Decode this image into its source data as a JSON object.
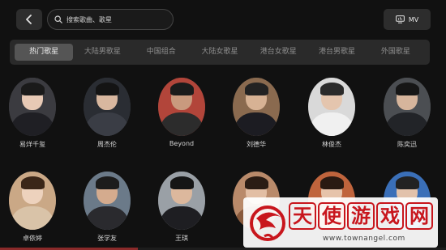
{
  "toolbar": {
    "back_icon": "chevron-left-icon",
    "search_placeholder": "搜索歌曲、歌星",
    "search_icon": "search-icon",
    "mv_label": "MV",
    "mv_icon": "mv-screen-icon"
  },
  "tabs": [
    {
      "label": "热门歌星",
      "active": true
    },
    {
      "label": "大陆男歌星",
      "active": false
    },
    {
      "label": "中国组合",
      "active": false
    },
    {
      "label": "大陆女歌星",
      "active": false
    },
    {
      "label": "港台女歌星",
      "active": false
    },
    {
      "label": "港台男歌星",
      "active": false
    },
    {
      "label": "外国歌星",
      "active": false
    }
  ],
  "artists": [
    {
      "name": "易烊千玺",
      "bg": "#3b3b40",
      "skin": "#e7c9b5",
      "hair": "#1a1a1a",
      "cloth": "#1f1f24"
    },
    {
      "name": "周杰伦",
      "bg": "#2a2d33",
      "skin": "#d8b79f",
      "hair": "#141414",
      "cloth": "#3a3d45"
    },
    {
      "name": "Beyond",
      "bg": "#b2453a",
      "skin": "#c99a7e",
      "hair": "#1b1b1b",
      "cloth": "#2c2c2c"
    },
    {
      "name": "刘德华",
      "bg": "#8a6a4f",
      "skin": "#d7b294",
      "hair": "#222222",
      "cloth": "#1c1c22"
    },
    {
      "name": "林俊杰",
      "bg": "#d9d9d9",
      "skin": "#e4c5ae",
      "hair": "#2a2a2a",
      "cloth": "#f0f0f0"
    },
    {
      "name": "陈奕迅",
      "bg": "#4b4e52",
      "skin": "#d6b59c",
      "hair": "#161616",
      "cloth": "#222428"
    },
    {
      "name": "卓依婷",
      "bg": "#caa886",
      "skin": "#edd2bd",
      "hair": "#3a2618",
      "cloth": "#d9c3a8"
    },
    {
      "name": "张学友",
      "bg": "#6b7a89",
      "skin": "#d4ab8e",
      "hair": "#1c1c1c",
      "cloth": "#2a2a2e"
    },
    {
      "name": "王琪",
      "bg": "#9aa0a6",
      "skin": "#dcb89d",
      "hair": "#151515",
      "cloth": "#1e1e22"
    },
    {
      "name": "",
      "bg": "#b98a6a",
      "skin": "#e2bea4",
      "hair": "#2a1c14",
      "cloth": "#8a5a3c"
    },
    {
      "name": "",
      "bg": "#c0643c",
      "skin": "#e6c3aa",
      "hair": "#2a1a12",
      "cloth": "#d07a4a"
    },
    {
      "name": "",
      "bg": "#3a6fb8",
      "skin": "#e2c2ab",
      "hair": "#222222",
      "cloth": "#4a7ac4"
    }
  ],
  "watermark": {
    "chars": [
      "天",
      "使",
      "游",
      "戏",
      "网"
    ],
    "url": "www.townangel.com"
  }
}
